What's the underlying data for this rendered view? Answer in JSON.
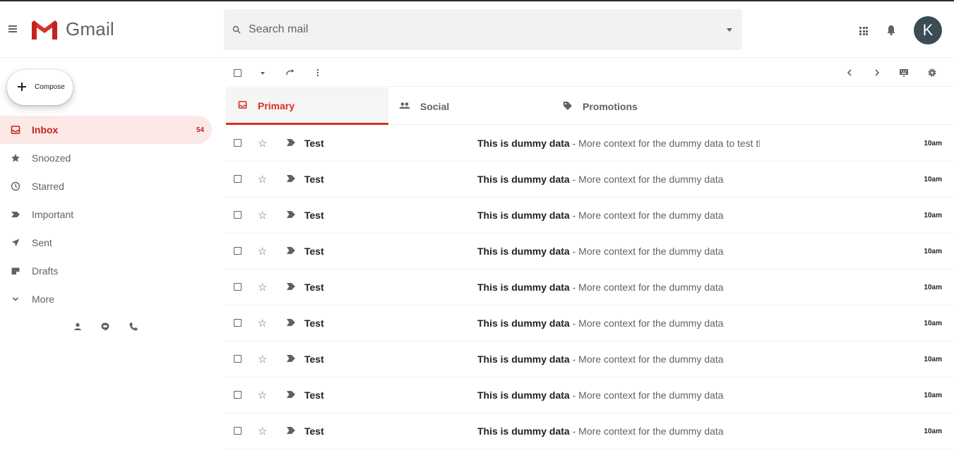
{
  "header": {
    "logo_text": "Gmail",
    "search_placeholder": "Search mail",
    "avatar_initial": "K"
  },
  "sidebar": {
    "compose_label": "Compose",
    "items": [
      {
        "label": "Inbox",
        "icon": "inbox-icon",
        "count": "54",
        "active": true
      },
      {
        "label": "Snoozed",
        "icon": "star-icon"
      },
      {
        "label": "Starred",
        "icon": "clock-icon"
      },
      {
        "label": "Important",
        "icon": "label-important-icon"
      },
      {
        "label": "Sent",
        "icon": "send-icon"
      },
      {
        "label": "Drafts",
        "icon": "draft-icon"
      },
      {
        "label": "More",
        "icon": "chevron-down-icon"
      }
    ]
  },
  "tabs": [
    {
      "label": "Primary",
      "icon": "inbox-icon",
      "active": true
    },
    {
      "label": "Social",
      "icon": "people-icon"
    },
    {
      "label": "Promotions",
      "icon": "tag-icon"
    }
  ],
  "emails": [
    {
      "sender": "Test",
      "subject": "This is dummy data",
      "snippet": "More context for the dummy data to test th...",
      "time": "10am"
    },
    {
      "sender": "Test",
      "subject": "This is dummy data",
      "snippet": "More context for the dummy data",
      "time": "10am"
    },
    {
      "sender": "Test",
      "subject": "This is dummy data",
      "snippet": "More context for the dummy data",
      "time": "10am"
    },
    {
      "sender": "Test",
      "subject": "This is dummy data",
      "snippet": "More context for the dummy data",
      "time": "10am"
    },
    {
      "sender": "Test",
      "subject": "This is dummy data",
      "snippet": "More context for the dummy data",
      "time": "10am"
    },
    {
      "sender": "Test",
      "subject": "This is dummy data",
      "snippet": "More context for the dummy data",
      "time": "10am"
    },
    {
      "sender": "Test",
      "subject": "This is dummy data",
      "snippet": "More context for the dummy data",
      "time": "10am"
    },
    {
      "sender": "Test",
      "subject": "This is dummy data",
      "snippet": "More context for the dummy data",
      "time": "10am"
    },
    {
      "sender": "Test",
      "subject": "This is dummy data",
      "snippet": "More context for the dummy data",
      "time": "10am"
    }
  ],
  "colors": {
    "accent": "#d93025",
    "active_bg": "#fce8e6",
    "avatar_bg": "#3c4c55"
  }
}
